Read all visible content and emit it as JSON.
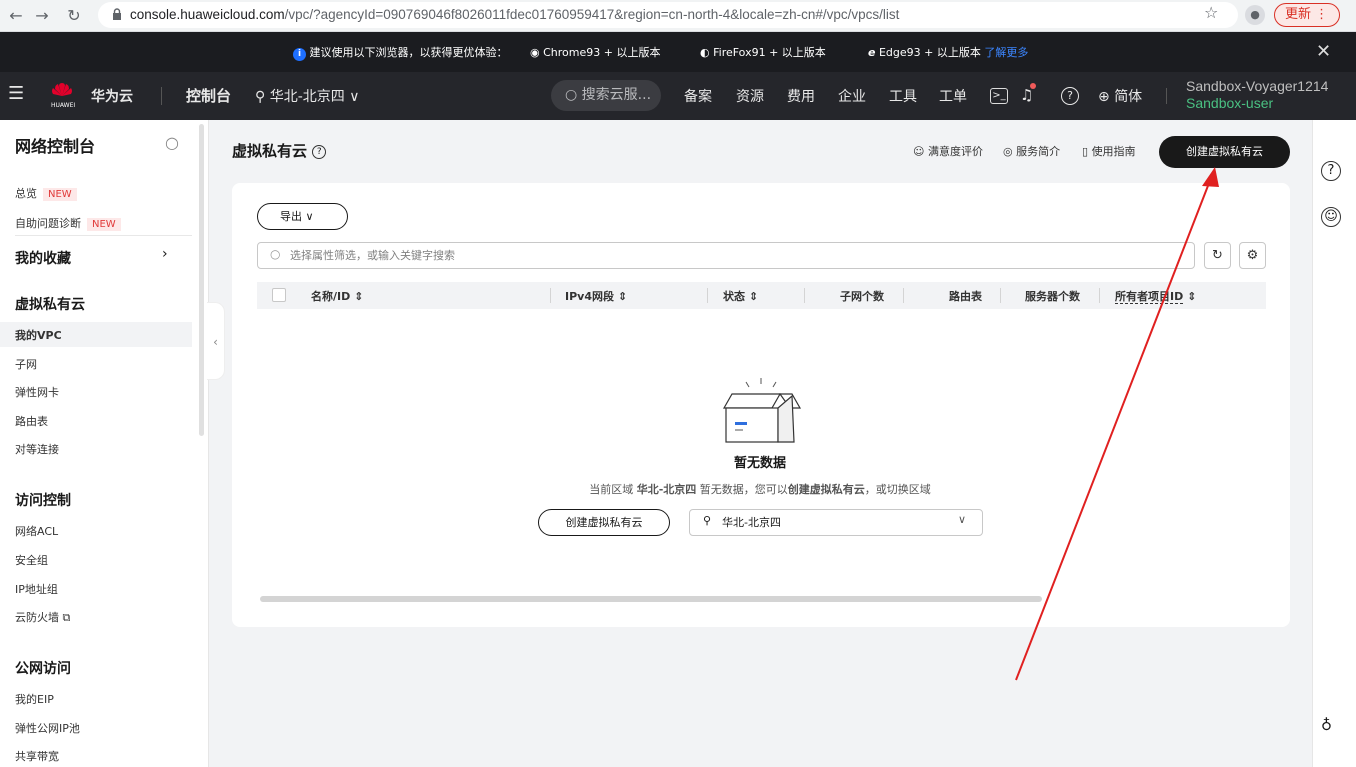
{
  "browser": {
    "url_host": "console.huaweicloud.com",
    "url_path": "/vpc/?agencyId=090769046f8026011fdec01760959417&region=cn-north-4&locale=zh-cn#/vpc/vpcs/list",
    "update_label": "更新"
  },
  "notice": {
    "text": "建议使用以下浏览器，以获得更优体验：",
    "browsers": [
      "Chrome93 + 以上版本",
      "FireFox91 + 以上版本",
      "Edge93 + 以上版本"
    ],
    "learn_more": "了解更多"
  },
  "topnav": {
    "brand": "华为云",
    "brand_sub": "HUAWEI",
    "console": "控制台",
    "region": "华北-北京四",
    "search_placeholder": "搜索云服...",
    "links": [
      "备案",
      "资源",
      "费用",
      "企业",
      "工具",
      "工单"
    ],
    "language": "简体",
    "account_name": "Sandbox-Voyager1214",
    "account_role": "Sandbox-user"
  },
  "sidebar": {
    "title": "网络控制台",
    "overview": "总览",
    "self_diag": "自助问题诊断",
    "new_badge": "NEW",
    "favorites": "我的收藏",
    "vpc_section": "虚拟私有云",
    "vpc_items": [
      "我的VPC",
      "子网",
      "弹性网卡",
      "路由表",
      "对等连接"
    ],
    "access_section": "访问控制",
    "access_items": [
      "网络ACL",
      "安全组",
      "IP地址组",
      "云防火墙"
    ],
    "public_section": "公网访问",
    "public_items": [
      "我的EIP",
      "弹性公网IP池",
      "共享带宽"
    ]
  },
  "main": {
    "title": "虚拟私有云",
    "header_links": [
      "满意度评价",
      "服务简介",
      "使用指南"
    ],
    "create_button": "创建虚拟私有云",
    "export_label": "导出",
    "filter_placeholder": "选择属性筛选，或输入关键字搜索",
    "columns": [
      "名称/ID",
      "IPv4网段",
      "状态",
      "子网个数",
      "路由表",
      "服务器个数",
      "所有者项目ID"
    ],
    "empty_title": "暂无数据",
    "empty_desc_1": "当前区域 ",
    "empty_desc_region": "华北-北京四",
    "empty_desc_2": " 暂无数据，您可以",
    "empty_desc_link": "创建虚拟私有云",
    "empty_desc_3": "，或切换区域",
    "empty_create_button": "创建虚拟私有云",
    "region_select": "华北-北京四"
  }
}
